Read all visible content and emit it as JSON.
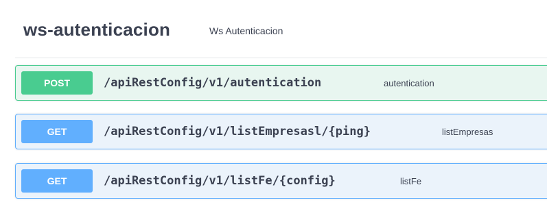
{
  "tag": {
    "name": "ws-autenticacion",
    "description": "Ws Autenticacion"
  },
  "operations": [
    {
      "method": "POST",
      "path": "/apiRestConfig/v1/autentication",
      "summary": "autentication",
      "color": "#49cc90"
    },
    {
      "method": "GET",
      "path": "/apiRestConfig/v1/listEmpresasl/{ping}",
      "summary": "listEmpresas",
      "color": "#61affe"
    },
    {
      "method": "GET",
      "path": "/apiRestConfig/v1/listFe/{config}",
      "summary": "listFe",
      "color": "#61affe"
    }
  ]
}
